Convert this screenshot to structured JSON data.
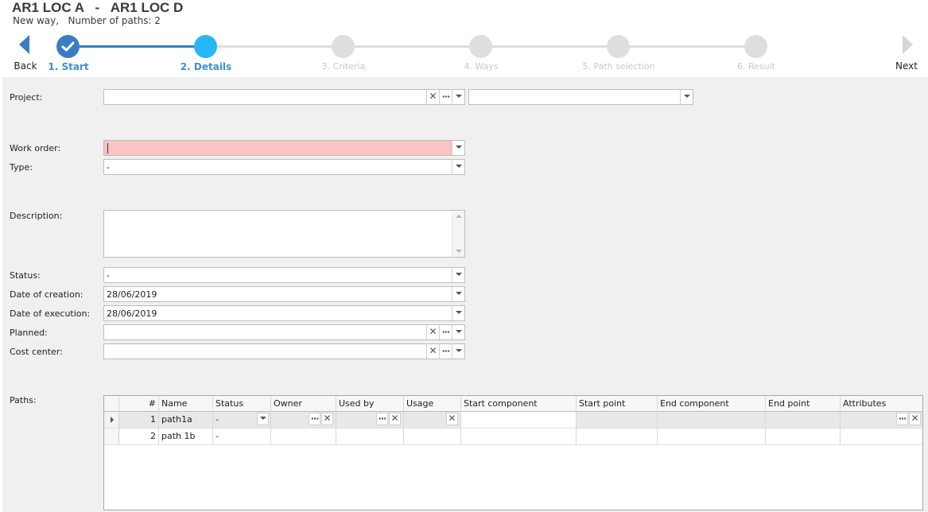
{
  "header": {
    "title": "AR1 LOC A   -   AR1 LOC D",
    "subtitle": "New way,   Number of paths: 2"
  },
  "wizard": {
    "back_label": "Back",
    "next_label": "Next",
    "steps": [
      {
        "label": "1. Start",
        "state": "done"
      },
      {
        "label": "2. Details",
        "state": "current"
      },
      {
        "label": "3. Criteria",
        "state": "pending"
      },
      {
        "label": "4. Ways",
        "state": "pending"
      },
      {
        "label": "5. Path selection",
        "state": "pending"
      },
      {
        "label": "6. Result",
        "state": "pending"
      }
    ]
  },
  "form": {
    "project_label": "Project:",
    "project_value": "",
    "project_secondary_value": "",
    "work_order_label": "Work order:",
    "work_order_value": "",
    "type_label": "Type:",
    "type_value": "-",
    "description_label": "Description:",
    "description_value": "",
    "status_label": "Status:",
    "status_value": "-",
    "creation_label": "Date of creation:",
    "creation_value": "28/06/2019",
    "execution_label": "Date of execution:",
    "execution_value": "28/06/2019",
    "planned_label": "Planned:",
    "planned_value": "",
    "cost_center_label": "Cost center:",
    "cost_center_value": "",
    "paths_label": "Paths:"
  },
  "paths_grid": {
    "columns": [
      "#",
      "Name",
      "Status",
      "Owner",
      "Used by",
      "Usage",
      "Start component",
      "Start point",
      "End component",
      "End point",
      "Attributes"
    ],
    "rows": [
      {
        "num": "1",
        "name": "path1a",
        "status": "-",
        "owner": "",
        "used_by": "",
        "usage": "",
        "start_component": "",
        "start_point": "",
        "end_component": "",
        "end_point": "",
        "attributes": ""
      },
      {
        "num": "2",
        "name": "path 1b",
        "status": "-",
        "owner": "",
        "used_by": "",
        "usage": "",
        "start_component": "",
        "start_point": "",
        "end_component": "",
        "end_point": "",
        "attributes": ""
      }
    ]
  },
  "colors": {
    "accent": "#3b7cc4",
    "current_step": "#29b6f6",
    "error_field": "#f8c4c4"
  }
}
